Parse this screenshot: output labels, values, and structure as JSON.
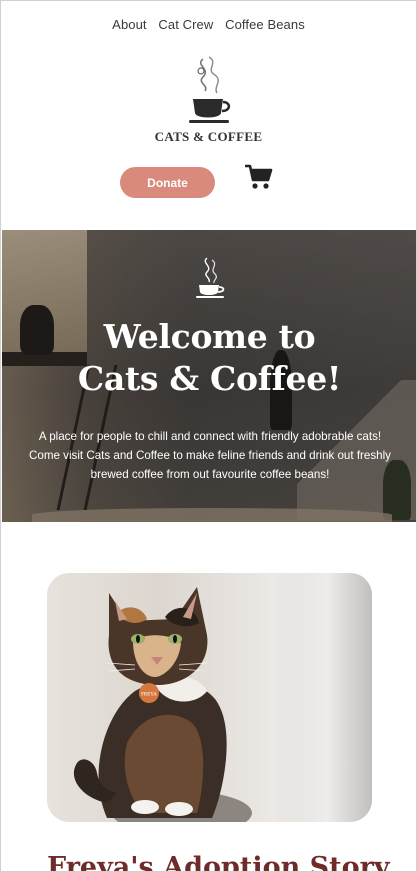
{
  "nav": {
    "items": [
      {
        "label": "About"
      },
      {
        "label": "Cat Crew"
      },
      {
        "label": "Coffee Beans"
      }
    ]
  },
  "logo": {
    "text": "CATS & COFFEE"
  },
  "actions": {
    "donate_label": "Donate",
    "cart_icon": "shopping-cart-icon"
  },
  "hero": {
    "icon": "coffee-cup-icon",
    "title_line1": "Welcome to",
    "title_line2": "Cats & Coffee!",
    "description": "A place for people to chill and connect with friendly adobrable cats! Come visit Cats and Coffee to make feline friends and drink out freshly brewed coffee from out favourite coffee beans!"
  },
  "feature": {
    "tag_text": "FREYA",
    "heading": "Freya's Adoption Story"
  },
  "colors": {
    "accent": "#d98a7c",
    "heading": "#6e2b2a",
    "text": "#333333"
  }
}
